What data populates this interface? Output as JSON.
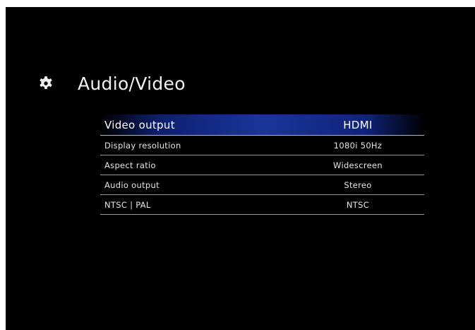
{
  "page": {
    "title": "Audio/Video",
    "icon": "gear-icon"
  },
  "settings": [
    {
      "label": "Video output",
      "value": "HDMI",
      "selected": true
    },
    {
      "label": "Display resolution",
      "value": "1080i 50Hz",
      "selected": false
    },
    {
      "label": "Aspect ratio",
      "value": "Widescreen",
      "selected": false
    },
    {
      "label": "Audio output",
      "value": "Stereo",
      "selected": false
    },
    {
      "label": "NTSC | PAL",
      "value": "NTSC",
      "selected": false
    }
  ],
  "colors": {
    "background": "#000000",
    "highlight": "#1a3599",
    "text": "#e6e6e6"
  }
}
